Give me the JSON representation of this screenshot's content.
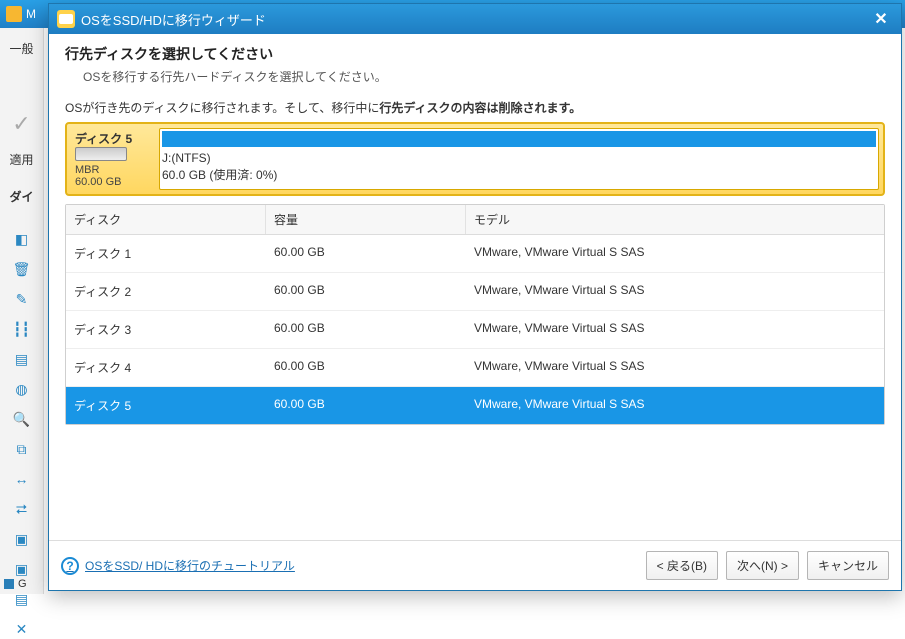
{
  "bgApp": {
    "title": "M",
    "tabs": {
      "general": "一般",
      "apply": "適用",
      "disk_partial": "ダイ"
    },
    "bottom": "G"
  },
  "modal": {
    "title": "OSをSSD/HDに移行ウィザード",
    "heading": "行先ディスクを選択してください",
    "subheading": "OSを移行する行先ハードディスクを選択してください。",
    "explain_prefix": "OSが行き先のディスクに移行されます。そして、移行中に",
    "explain_bold": "行先ディスクの内容は削除されます。"
  },
  "selectedDisk": {
    "name": "ディスク 5",
    "scheme": "MBR",
    "size": "60.00 GB",
    "part_label": "J:(NTFS)",
    "part_size": "60.0 GB (使用済: 0%)"
  },
  "list": {
    "headers": {
      "disk": "ディスク",
      "capacity": "容量",
      "model": "モデル"
    },
    "rows": [
      {
        "disk": "ディスク 1",
        "capacity": "60.00 GB",
        "model": "VMware, VMware Virtual S SAS",
        "selected": false
      },
      {
        "disk": "ディスク 2",
        "capacity": "60.00 GB",
        "model": "VMware, VMware Virtual S SAS",
        "selected": false
      },
      {
        "disk": "ディスク 3",
        "capacity": "60.00 GB",
        "model": "VMware, VMware Virtual S SAS",
        "selected": false
      },
      {
        "disk": "ディスク 4",
        "capacity": "60.00 GB",
        "model": "VMware, VMware Virtual S SAS",
        "selected": false
      },
      {
        "disk": "ディスク 5",
        "capacity": "60.00 GB",
        "model": "VMware, VMware Virtual S SAS",
        "selected": true
      }
    ]
  },
  "footer": {
    "tutorial": "OSをSSD/ HDに移行のチュートリアル",
    "back": "< 戻る(B)",
    "next": "次へ(N) >",
    "cancel": "キャンセル"
  }
}
